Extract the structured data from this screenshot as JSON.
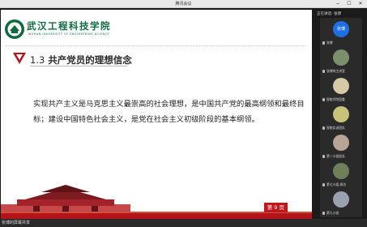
{
  "window": {
    "title": "腾讯会议"
  },
  "slide": {
    "logo_cn": "武汉工程科技学院",
    "logo_en": "WUHAN UNIVERSITY OF ENGINEERING SCIENCE",
    "heading_num": "1.3",
    "heading_text": "共产党员的理想信念",
    "body": "实现共产主义是马克思主义最崇高的社会理想，是中国共产党的最高纲领和最终目标；建设中国特色社会主义，是党在社会主义初级阶段的基本纲领。",
    "page_label": "第 9 页"
  },
  "panel": {
    "title": "正在讲话: 张博",
    "participants": [
      {
        "name": "张博",
        "avatar_text": "张博",
        "color": "#1f6fe0"
      },
      {
        "name": "张博的主讲室",
        "avatar_text": "",
        "color": "#7a8f6a"
      },
      {
        "name": "智能学院团委",
        "avatar_text": "",
        "color": "#d7c9a6"
      },
      {
        "name": "智能实训团队",
        "avatar_text": "",
        "color": "#c8c27a"
      },
      {
        "name": "第二小组组长",
        "avatar_text": "",
        "color": "#b8a598"
      },
      {
        "name": "第七小组-周总",
        "avatar_text": "",
        "color": "#6f7f5a"
      },
      {
        "name": "第九小组",
        "avatar_text": "",
        "color": "#9aa2b2"
      }
    ]
  },
  "statusbar": {
    "text": "张博的屏幕共享"
  }
}
